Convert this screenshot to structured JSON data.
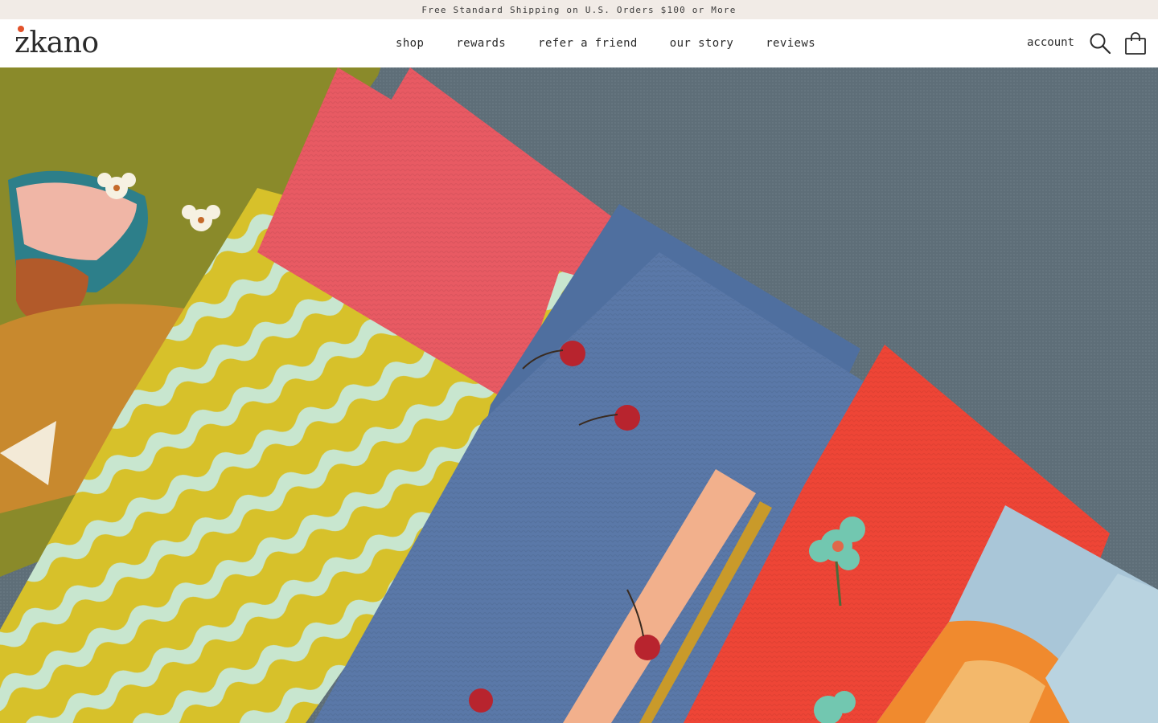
{
  "announcement": {
    "text": "Free Standard Shipping on U.S. Orders $100 or More"
  },
  "brand": {
    "name": "zkano",
    "accent": "#e2522b"
  },
  "nav": {
    "items": [
      {
        "label": "shop"
      },
      {
        "label": "rewards"
      },
      {
        "label": "refer a friend"
      },
      {
        "label": "our story"
      },
      {
        "label": "reviews"
      }
    ]
  },
  "header_right": {
    "account_label": "account",
    "search_icon": "search-icon",
    "cart_icon": "shopping-bag-icon"
  },
  "colors": {
    "announcement_bg": "#f1ebe6",
    "hero_bg": "#5b6b75",
    "olive": "#8a8a2a",
    "coral": "#e85a63",
    "mustard": "#d7c12a",
    "mint": "#c8e6cf",
    "denim": "#5a78a8",
    "red": "#ee4536",
    "sky": "#a9c6d8",
    "orange": "#f08a2e"
  }
}
